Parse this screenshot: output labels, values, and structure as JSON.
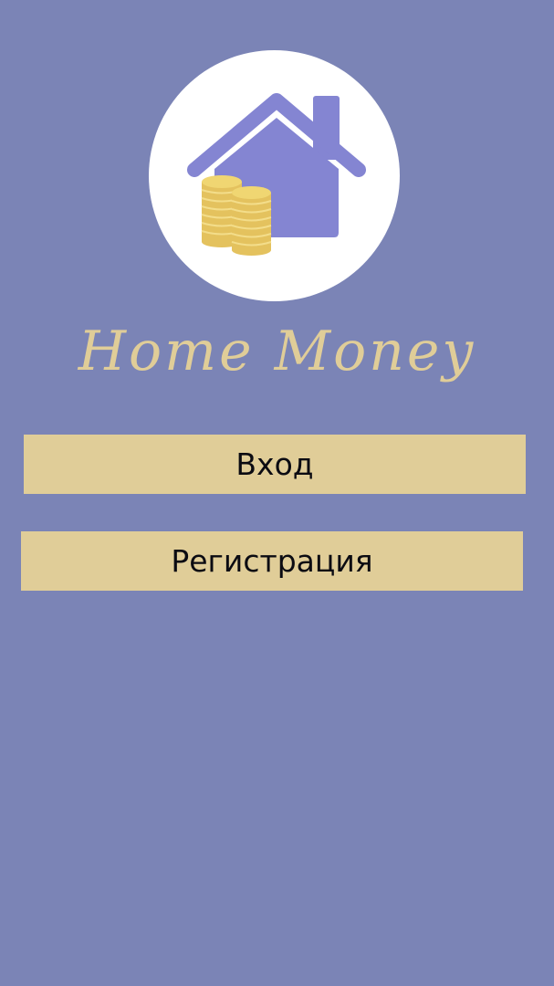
{
  "app": {
    "title": "Home Money",
    "logo_icon": "house-with-coins-icon"
  },
  "actions": {
    "login_label": "Вход",
    "register_label": "Регистрация"
  },
  "colors": {
    "background": "#7b84b6",
    "accent": "#e0cd98",
    "house": "#8485d2",
    "coins": "#eed36e"
  }
}
